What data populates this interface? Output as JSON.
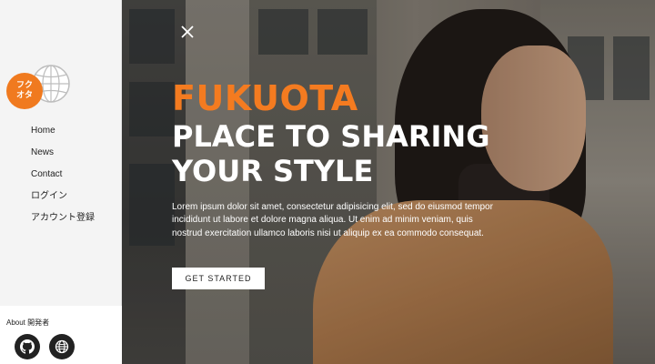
{
  "sidebar": {
    "logo_text_line1": "フク",
    "logo_text_line2": "オタ",
    "nav": [
      {
        "label": "Home"
      },
      {
        "label": "News"
      },
      {
        "label": "Contact"
      },
      {
        "label": "ログイン"
      },
      {
        "label": "アカウント登録"
      }
    ],
    "footer": {
      "about_label": "About 開発者",
      "links": [
        {
          "icon": "github-icon"
        },
        {
          "icon": "globe-icon"
        }
      ]
    }
  },
  "hero": {
    "title": "FUKUOTA",
    "headline": "PLACE TO SHARING YOUR STYLE",
    "body": "Lorem ipsum dolor sit amet, consectetur adipisicing elit, sed do eiusmod tempor incididunt ut labore et dolore magna aliqua. Ut enim ad minim veniam, quis nostrud exercitation ullamco laboris nisi ut aliquip ex ea commodo consequat.",
    "cta_label": "GET STARTED"
  },
  "colors": {
    "accent": "#f47b20",
    "logo": "#f07a1f",
    "sidebar_bg": "#f4f4f4",
    "text_dark": "#222222"
  }
}
